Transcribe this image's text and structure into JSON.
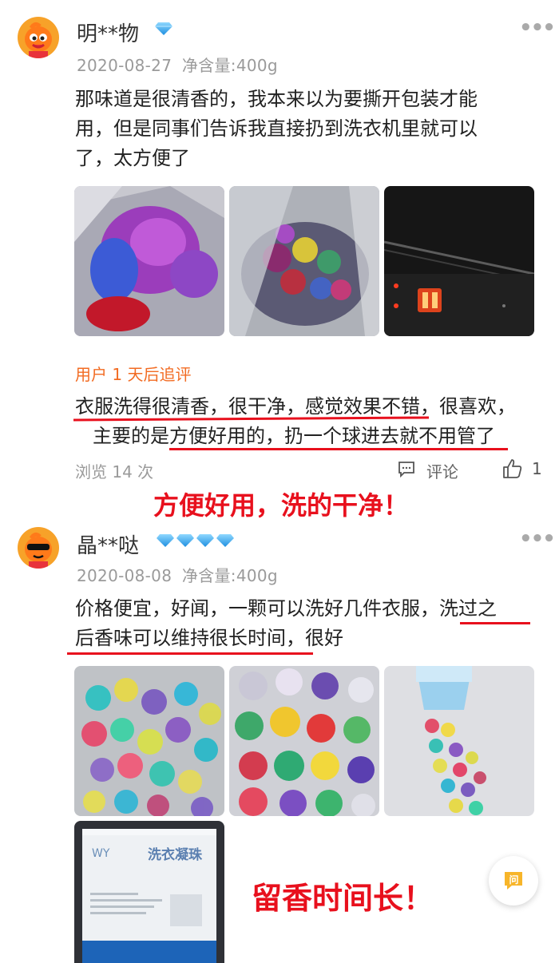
{
  "reviews": [
    {
      "username": "明**物",
      "date": "2020-08-27",
      "spec": "净含量:400g",
      "line1": "那味道是很清香的，我本来以为要撕开包装才能",
      "line2": "用，但是同事们告诉我直接扔到洗衣机里就可以",
      "line3": "了，太方便了",
      "followup_title": "用户 1 天后追评",
      "followup_line1": "衣服洗得很清香，很干净，感觉效果不错，很喜欢，",
      "followup_line2": "主要的是方便好用的，扔一个球进去就不用管了",
      "views_label": "浏览 14 次",
      "comment_label": "评论",
      "like_count": "1",
      "overlay_caption": "方便好用，洗的干净！"
    },
    {
      "username": "晶**哒",
      "date": "2020-08-08",
      "spec": "净含量:400g",
      "line1": "价格便宜，好闻，一颗可以洗好几件衣服，洗过之",
      "line2": "后香味可以维持很长时间，很好",
      "package_text": "洗衣凝珠",
      "overlay_caption": "留香时间长！"
    }
  ],
  "colors": {
    "accent_red": "#e8101d",
    "followup_orange": "#f26b22",
    "avatar_orange": "#f7a229",
    "gem_blue": "#3fa9f5"
  },
  "icons": [
    "more-icon",
    "diamond-icon",
    "comment-icon",
    "thumbs-up-icon",
    "question-icon"
  ]
}
